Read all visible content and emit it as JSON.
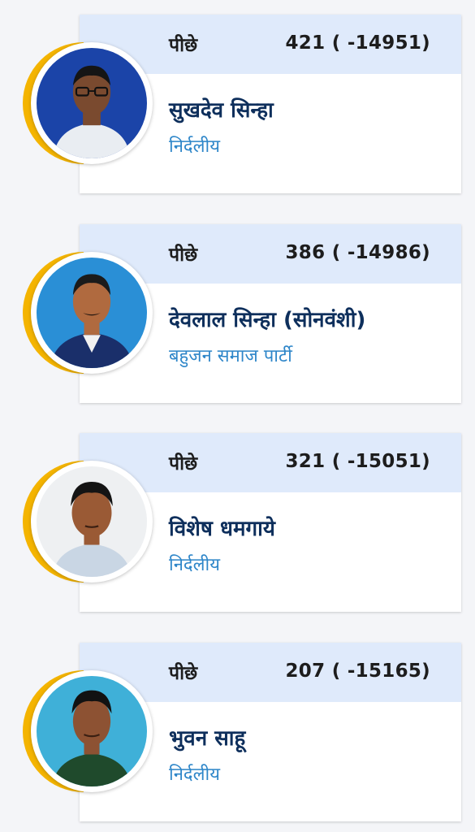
{
  "candidates": [
    {
      "status": "पीछे",
      "votes": "421 ( -14951)",
      "name": "सुखदेव सिन्हा",
      "party": "निर्दलीय",
      "photo_bg": "#1b44a8",
      "shirt": "#e9edf2",
      "skin": "#7a4a2f"
    },
    {
      "status": "पीछे",
      "votes": "386 ( -14986)",
      "name": "देवलाल सिन्हा (सोनवंशी)",
      "party": "बहुजन समाज पार्टी",
      "photo_bg": "#2a8fd6",
      "shirt": "#1a2f6a",
      "skin": "#b06a3f"
    },
    {
      "status": "पीछे",
      "votes": "321 ( -15051)",
      "name": "विशेष धमगाये",
      "party": "निर्दलीय",
      "photo_bg": "#eef0f2",
      "shirt": "#c9d6e4",
      "skin": "#9a5a35"
    },
    {
      "status": "पीछे",
      "votes": "207 ( -15165)",
      "name": "भुवन साहू",
      "party": "निर्दलीय",
      "photo_bg": "#3fb0d8",
      "shirt": "#1f4a2c",
      "skin": "#8d5233"
    }
  ],
  "colors": {
    "accent_arc": "#f4b400",
    "header_bg": "#dfeafb",
    "name_color": "#0e2f5c",
    "party_color": "#2e86c9"
  }
}
